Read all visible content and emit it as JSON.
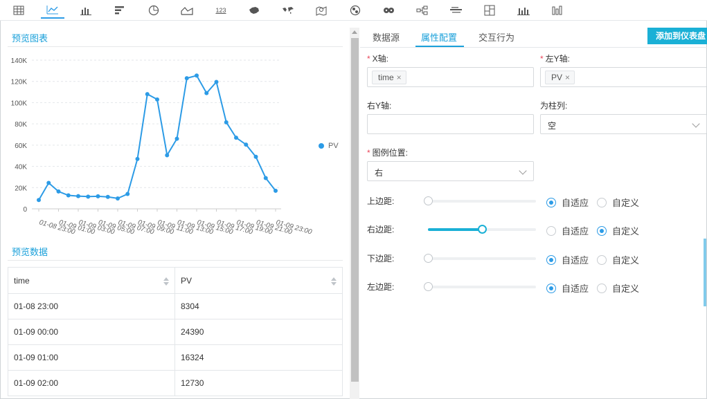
{
  "toolbar": {
    "tools": [
      {
        "name": "table-chart-tool",
        "icon": "table-icon"
      },
      {
        "name": "line-chart-tool",
        "icon": "line-chart-icon",
        "active": true
      },
      {
        "name": "bar-chart-tool",
        "icon": "bar-chart-icon"
      },
      {
        "name": "horizontal-bar-tool",
        "icon": "horizontal-bar-icon"
      },
      {
        "name": "pie-chart-tool",
        "icon": "pie-chart-icon"
      },
      {
        "name": "area-chart-tool",
        "icon": "area-chart-icon"
      },
      {
        "name": "kpi-tool",
        "icon": "kpi-number-icon",
        "text": "123"
      },
      {
        "name": "china-map-tool",
        "icon": "china-map-icon"
      },
      {
        "name": "world-map-tool",
        "icon": "world-map-icon"
      },
      {
        "name": "location-map-tool",
        "icon": "map-pin-icon"
      },
      {
        "name": "bubble-chart-tool",
        "icon": "bubble-chart-icon"
      },
      {
        "name": "scatter-map-tool",
        "icon": "scatter-map-icon"
      },
      {
        "name": "relation-graph-tool",
        "icon": "relation-graph-icon"
      },
      {
        "name": "word-cloud-tool",
        "icon": "word-cloud-icon"
      },
      {
        "name": "treemap-tool",
        "icon": "treemap-icon"
      },
      {
        "name": "waterfall-tool",
        "icon": "waterfall-icon"
      },
      {
        "name": "stacked-bar-tool",
        "icon": "stacked-bar-icon"
      }
    ]
  },
  "preview_chart": {
    "title": "预览图表",
    "legend": "PV",
    "series_color": "#2c9be6"
  },
  "chart_data": {
    "type": "line",
    "title": "",
    "xlabel": "",
    "ylabel": "",
    "x_tick_labels": [
      "01-08 23:00",
      "01-09 01:00",
      "01-09 03:00",
      "01-09 05:00",
      "01-09 07:00",
      "01-09 09:00",
      "01-09 11:00",
      "01-09 13:00",
      "01-09 15:00",
      "01-09 17:00",
      "01-09 19:00",
      "01-09 21:00",
      "01-09 23:00"
    ],
    "y_tick_labels": [
      "0",
      "20K",
      "40K",
      "60K",
      "80K",
      "100K",
      "120K",
      "140K"
    ],
    "ylim": [
      0,
      140000
    ],
    "grid": true,
    "legend_position": "right",
    "series": [
      {
        "name": "PV",
        "x": [
          "01-08 23:00",
          "01-09 00:00",
          "01-09 01:00",
          "01-09 02:00",
          "01-09 03:00",
          "01-09 04:00",
          "01-09 05:00",
          "01-09 06:00",
          "01-09 07:00",
          "01-09 08:00",
          "01-09 09:00",
          "01-09 10:00",
          "01-09 11:00",
          "01-09 12:00",
          "01-09 13:00",
          "01-09 14:00",
          "01-09 15:00",
          "01-09 16:00",
          "01-09 17:00",
          "01-09 18:00",
          "01-09 19:00",
          "01-09 20:00",
          "01-09 21:00",
          "01-09 22:00",
          "01-09 23:00"
        ],
        "values": [
          8304,
          24390,
          16324,
          12730,
          12000,
          11500,
          11800,
          11200,
          9800,
          14000,
          47000,
          108000,
          103000,
          50500,
          66000,
          123000,
          125500,
          109000,
          119500,
          81500,
          67000,
          60500,
          49000,
          29000,
          17000
        ]
      }
    ]
  },
  "preview_data": {
    "title": "预览数据",
    "columns": [
      "time",
      "PV"
    ],
    "rows": [
      [
        "01-08 23:00",
        "8304"
      ],
      [
        "01-09 00:00",
        "24390"
      ],
      [
        "01-09 01:00",
        "16324"
      ],
      [
        "01-09 02:00",
        "12730"
      ]
    ]
  },
  "config_panel": {
    "tabs": [
      "数据源",
      "属性配置",
      "交互行为"
    ],
    "active_tab": "属性配置",
    "add_button": "添加到仪表盘",
    "x_axis": {
      "label": "X轴:",
      "required": "*",
      "tag": "time"
    },
    "left_y_axis": {
      "label": "左Y轴:",
      "required": "*",
      "tag": "PV"
    },
    "right_y_axis": {
      "label": "右Y轴:",
      "value": ""
    },
    "as_column": {
      "label": "为柱列:",
      "value": "空"
    },
    "legend_position": {
      "label": "图例位置:",
      "required": "*",
      "value": "右"
    },
    "margins": [
      {
        "label": "上边距:",
        "mode": "auto",
        "slider_fraction": 0
      },
      {
        "label": "右边距:",
        "mode": "custom",
        "slider_fraction": 0.5
      },
      {
        "label": "下边距:",
        "mode": "auto",
        "slider_fraction": 0
      },
      {
        "label": "左边距:",
        "mode": "auto",
        "slider_fraction": 0
      }
    ],
    "option_auto": "自适应",
    "option_custom": "自定义"
  },
  "colors": {
    "accent": "#1aa0da",
    "button": "#1ab0d6",
    "line": "#2c9be6"
  }
}
